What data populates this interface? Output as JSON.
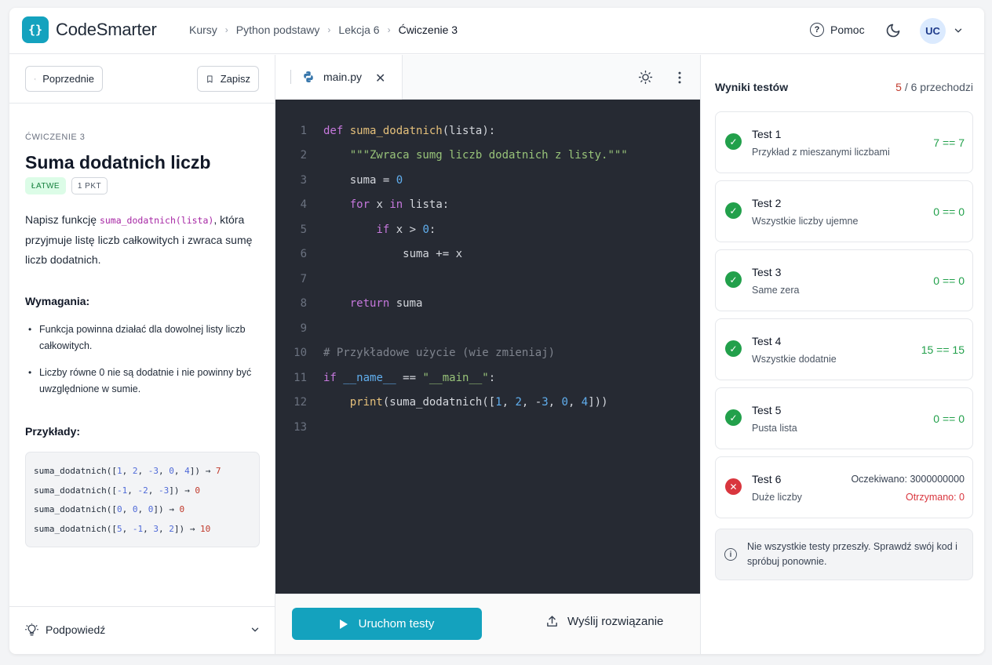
{
  "app": {
    "logo_glyph": "{}",
    "name": "CodeSmarter"
  },
  "breadcrumbs": [
    "Kursy",
    "Python podstawy",
    "Lekcja 6",
    "Ćwiczenie 3"
  ],
  "header": {
    "help_label": "Pomoc",
    "avatar_initials": "UC"
  },
  "left": {
    "prev_label": "Poprzednie",
    "save_label": "Zapisz",
    "exercise_tag": "ĆWICZENIE 3",
    "title": "Suma dodatnich liczb",
    "badge_difficulty": "ŁATWE",
    "badge_points": "1 PKT",
    "desc_pre": "Napisz funkcję ",
    "desc_code": "suma_dodatnich(lista)",
    "desc_post": ", która przyjmuje listę liczb całkowitych i zwraca sumę liczb dodatnich.",
    "requirements_heading": "Wymagania:",
    "requirements": [
      "Funkcja powinna działać dla dowolnej listy liczb całkowitych.",
      "Liczby równe 0 nie są dodatnie i nie powinny być uwzględnione w sumie."
    ],
    "examples_heading": "Przykłady:",
    "examples": [
      {
        "call": "suma_dodatnich",
        "args": [
          "1",
          "2",
          "-3",
          "0",
          "4"
        ],
        "result": "7"
      },
      {
        "call": "suma_dodatnich",
        "args": [
          "-1",
          "-2",
          "-3"
        ],
        "result": "0"
      },
      {
        "call": "suma_dodatnich",
        "args": [
          "0",
          "0",
          "0"
        ],
        "result": "0"
      },
      {
        "call": "suma_dodatnich",
        "args": [
          "5",
          "-1",
          "3",
          "2"
        ],
        "result": "10"
      }
    ],
    "hint_label": "Podpowiedź"
  },
  "editor": {
    "file_tab": "main.py",
    "code_lines": [
      "def suma_dodatnich(lista):",
      "    \"\"\"Zwraca sumg liczb dodatnich z listy.\"\"\"",
      "    suma = 0",
      "    for x in lista:",
      "        if x > 0:",
      "            suma += x",
      "",
      "    return suma",
      "",
      "# Przykładowe użycie (wie zmieniaj)",
      "if __name__ == \"__main__\":",
      "    print(suma_dodatnich([1, 2, -3, 0, 4]))",
      ""
    ],
    "run_label": "Uruchom testy",
    "submit_label": "Wyślij rozwiązanie"
  },
  "results": {
    "title": "Wyniki testów",
    "passed": "5",
    "total_text": " / 6 przechodzi",
    "tests": [
      {
        "name": "Test 1",
        "desc": "Przykład z mieszanymi liczbami",
        "status": "pass",
        "value": "7 == 7"
      },
      {
        "name": "Test 2",
        "desc": "Wszystkie liczby ujemne",
        "status": "pass",
        "value": "0 == 0"
      },
      {
        "name": "Test 3",
        "desc": "Same zera",
        "status": "pass",
        "value": "0 == 0"
      },
      {
        "name": "Test 4",
        "desc": "Wszystkie dodatnie",
        "status": "pass",
        "value": "15 == 15"
      },
      {
        "name": "Test 5",
        "desc": "Pusta lista",
        "status": "pass",
        "value": "0 == 0"
      },
      {
        "name": "Test 6",
        "desc": "Duże liczby",
        "status": "fail",
        "expected": "Oczekiwano: 3000000000",
        "got": "Otrzymano: 0"
      }
    ],
    "notice": "Nie wszystkie testy przeszły. Sprawdź swój kod i spróbuj ponownie."
  },
  "colors": {
    "accent": "#14a2be",
    "pass": "#22a04b",
    "fail": "#d9363e",
    "editor_bg": "#262a33"
  }
}
